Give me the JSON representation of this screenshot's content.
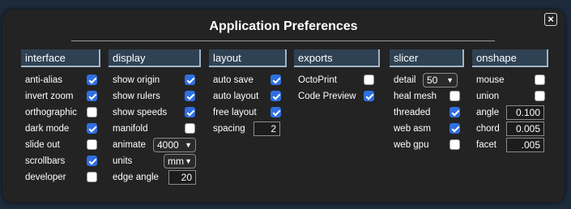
{
  "title": "Application Preferences",
  "close_label": "×",
  "interface": {
    "header": "interface",
    "items": [
      {
        "label": "anti-alias",
        "checked": true
      },
      {
        "label": "invert zoom",
        "checked": true
      },
      {
        "label": "orthographic",
        "checked": false
      },
      {
        "label": "dark mode",
        "checked": true
      },
      {
        "label": "slide out",
        "checked": false
      },
      {
        "label": "scrollbars",
        "checked": true
      },
      {
        "label": "developer",
        "checked": false
      }
    ]
  },
  "display": {
    "header": "display",
    "items": [
      {
        "label": "show origin",
        "checked": true
      },
      {
        "label": "show rulers",
        "checked": true
      },
      {
        "label": "show speeds",
        "checked": true
      },
      {
        "label": "manifold",
        "checked": false
      }
    ],
    "animate": {
      "label": "animate",
      "value": "4000"
    },
    "units": {
      "label": "units",
      "value": "mm"
    },
    "edge_angle": {
      "label": "edge angle",
      "value": "20"
    }
  },
  "layout": {
    "header": "layout",
    "items": [
      {
        "label": "auto save",
        "checked": true
      },
      {
        "label": "auto layout",
        "checked": true
      },
      {
        "label": "free layout",
        "checked": true
      }
    ],
    "spacing": {
      "label": "spacing",
      "value": "2"
    }
  },
  "exports": {
    "header": "exports",
    "items": [
      {
        "label": "OctoPrint",
        "checked": false
      },
      {
        "label": "Code Preview",
        "checked": true
      }
    ]
  },
  "slicer": {
    "header": "slicer",
    "detail": {
      "label": "detail",
      "value": "50"
    },
    "items": [
      {
        "label": "heal mesh",
        "checked": false
      },
      {
        "label": "threaded",
        "checked": true
      },
      {
        "label": "web asm",
        "checked": true
      },
      {
        "label": "web gpu",
        "checked": false
      }
    ]
  },
  "onshape": {
    "header": "onshape",
    "items": [
      {
        "label": "mouse",
        "checked": false
      },
      {
        "label": "union",
        "checked": false
      }
    ],
    "angle": {
      "label": "angle",
      "value": "0.100"
    },
    "chord": {
      "label": "chord",
      "value": "0.005"
    },
    "facet": {
      "label": "facet",
      "value": ".005"
    }
  }
}
